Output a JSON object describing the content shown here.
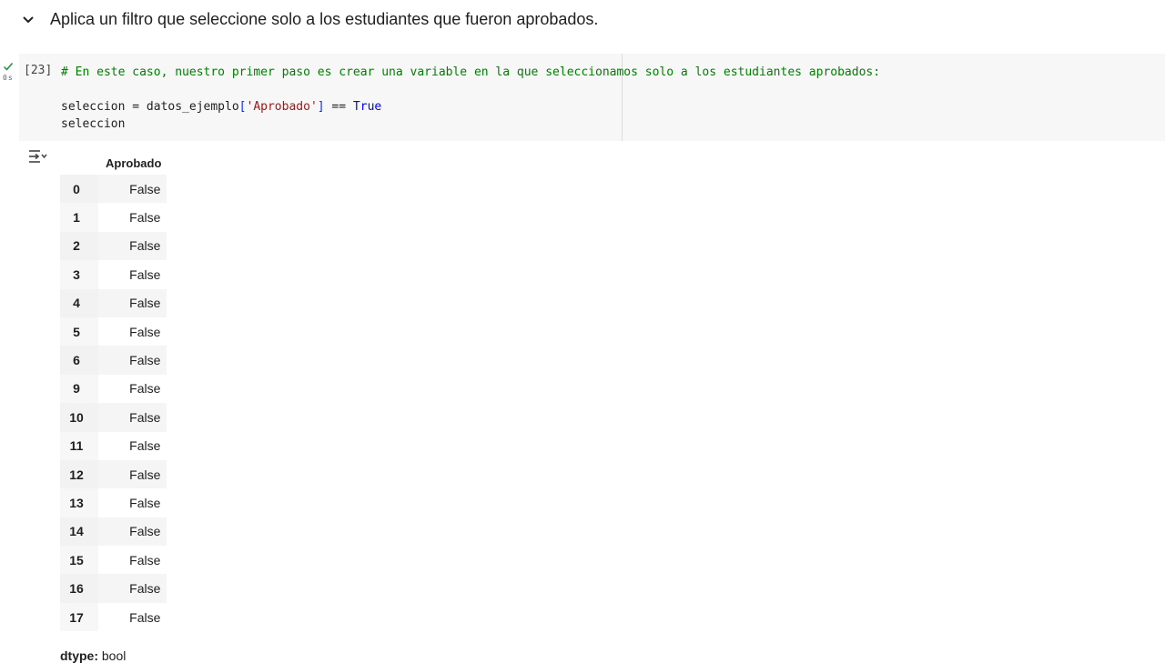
{
  "section": {
    "title": "Aplica un filtro que seleccione solo a los estudiantes que fueron aprobados."
  },
  "cell": {
    "execution_count": "[23]",
    "exec_time": "0s",
    "code": {
      "comment": "# En este caso, nuestro primer paso es crear una variable en la que seleccionamos solo a los estudiantes aprobados:",
      "line2_lhs": "seleccion = datos_ejemplo",
      "line2_open": "[",
      "line2_str": "'Aprobado'",
      "line2_close": "]",
      "line2_op": " == ",
      "line2_kw": "True",
      "line3": "seleccion"
    }
  },
  "output": {
    "column_header": "Aprobado",
    "rows": [
      {
        "index": "0",
        "value": "False"
      },
      {
        "index": "1",
        "value": "False"
      },
      {
        "index": "2",
        "value": "False"
      },
      {
        "index": "3",
        "value": "False"
      },
      {
        "index": "4",
        "value": "False"
      },
      {
        "index": "5",
        "value": "False"
      },
      {
        "index": "6",
        "value": "False"
      },
      {
        "index": "9",
        "value": "False"
      },
      {
        "index": "10",
        "value": "False"
      },
      {
        "index": "11",
        "value": "False"
      },
      {
        "index": "12",
        "value": "False"
      },
      {
        "index": "13",
        "value": "False"
      },
      {
        "index": "14",
        "value": "False"
      },
      {
        "index": "15",
        "value": "False"
      },
      {
        "index": "16",
        "value": "False"
      },
      {
        "index": "17",
        "value": "False"
      }
    ],
    "dtype_label": "dtype:",
    "dtype_value": " bool"
  },
  "colors": {
    "success": "#1e8e3e",
    "comment": "#008000",
    "string": "#a31515",
    "keyword": "#0000ff"
  },
  "icons": [
    "chevron-down-icon",
    "checkmark-icon",
    "output-actions-icon"
  ]
}
